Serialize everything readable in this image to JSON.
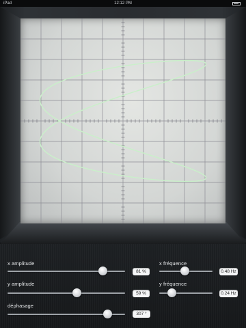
{
  "statusbar": {
    "carrier": "iPad",
    "time": "12:12 PM"
  },
  "scope": {
    "grid_divisions": 10,
    "trace_color": "#c9f0c9"
  },
  "controls": {
    "x_amplitude": {
      "label": "x amplitude",
      "value": "81 %",
      "level": 0.81
    },
    "y_amplitude": {
      "label": "y amplitude",
      "value": "59 %",
      "level": 0.59
    },
    "phase": {
      "label": "déphasage",
      "value": "307 °",
      "level": 0.853
    },
    "x_frequency": {
      "label": "x fréquence",
      "value": "0.48 Hz",
      "level": 0.48
    },
    "y_frequency": {
      "label": "y fréquence",
      "value": "0.24 Hz",
      "level": 0.24
    }
  }
}
